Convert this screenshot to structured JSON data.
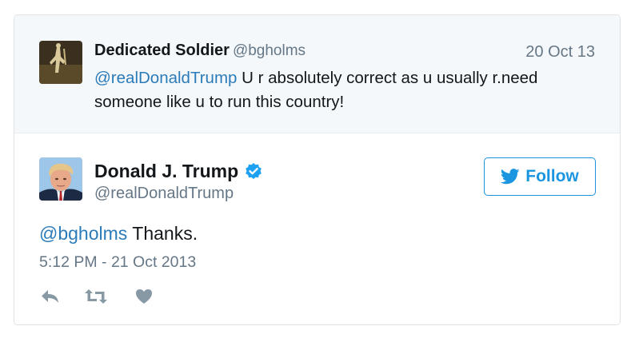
{
  "quoted_tweet": {
    "author_name": "Dedicated Soldier",
    "author_handle": "@bgholms",
    "date": "20 Oct 13",
    "mention": "@realDonaldTrump",
    "text_line1": " U r absolutely correct as u usually r.need",
    "text_line2": "someone like u to run this country!"
  },
  "tweet": {
    "author_name": "Donald J. Trump",
    "author_handle": "@realDonaldTrump",
    "follow_label": "Follow",
    "mention": "@bgholms",
    "text": " Thanks.",
    "timestamp": "5:12 PM - 21 Oct 2013"
  },
  "icons": {
    "verified": "verified-badge-icon",
    "follow": "twitter-bird-icon",
    "reply": "reply-icon",
    "retweet": "retweet-icon",
    "like": "heart-icon"
  },
  "colors": {
    "link": "#2b7bb9",
    "follow_blue": "#1b95e0",
    "muted": "#657786",
    "quoted_bg": "#f5f8fa"
  }
}
